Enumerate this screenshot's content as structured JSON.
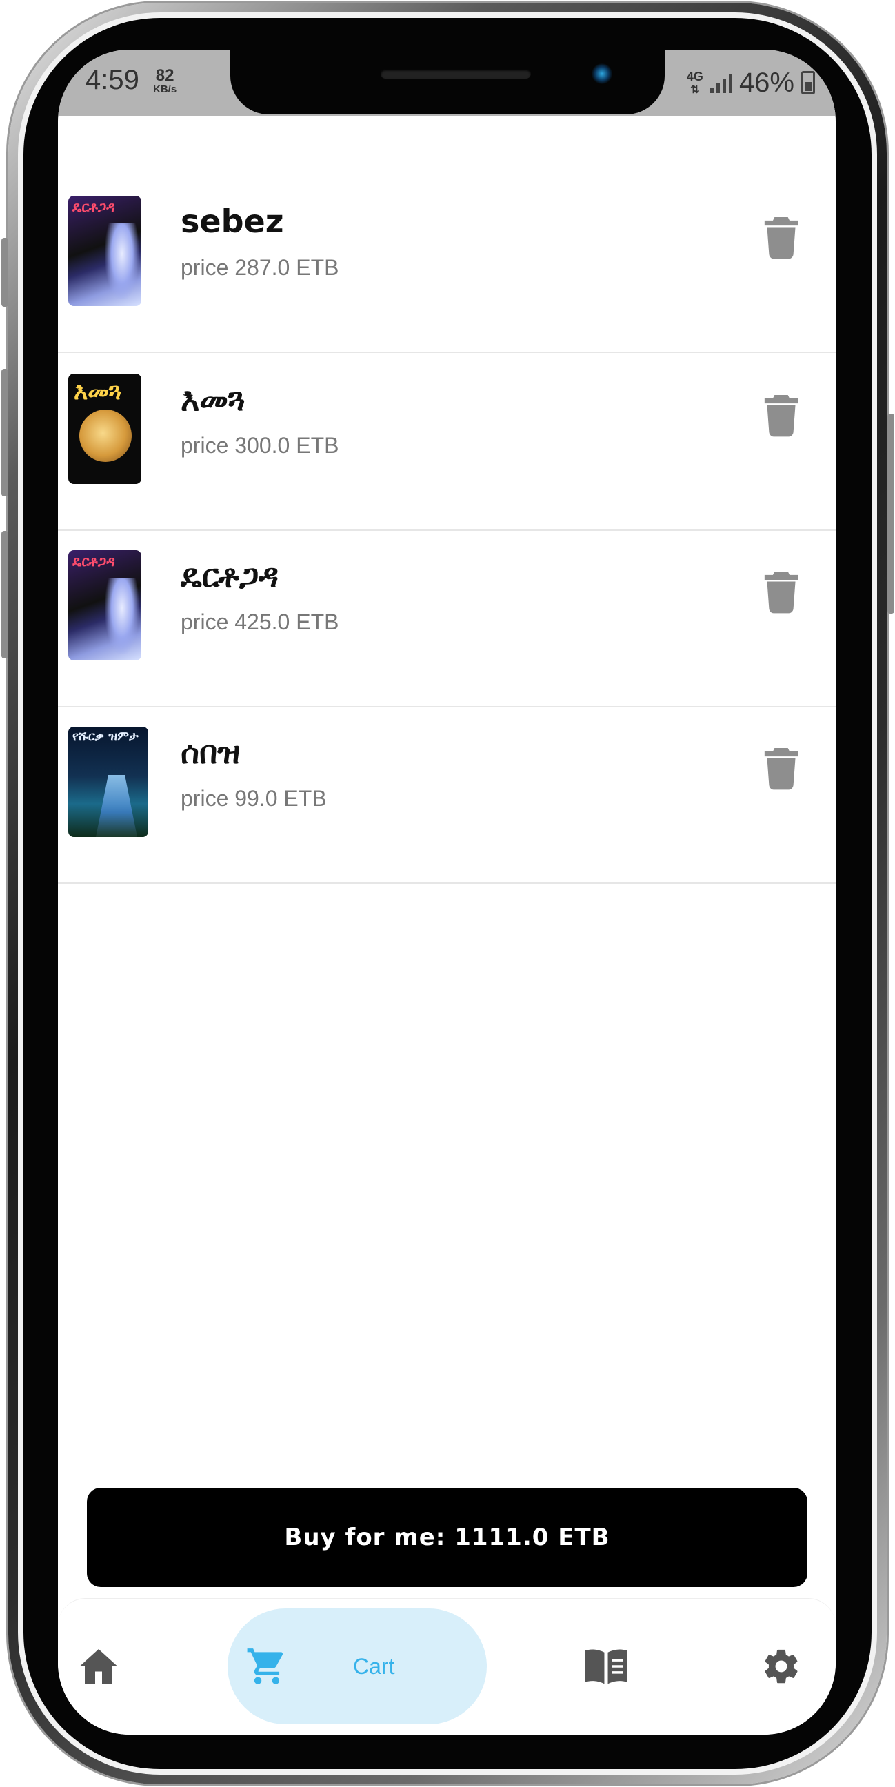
{
  "status_bar": {
    "time": "4:59",
    "speed_value": "82",
    "speed_unit": "KB/s",
    "network": "4G",
    "battery": "46%"
  },
  "cart_items": [
    {
      "title": "sebez",
      "price": "price 287.0 ETB",
      "cover_text": "ዴርቶጋዳ"
    },
    {
      "title": "እመጓ",
      "price": "price 300.0 ETB",
      "cover_text": "እመጓ"
    },
    {
      "title": "ዴርቶጋዳ",
      "price": "price 425.0 ETB",
      "cover_text": "ዴርቶጋዳ"
    },
    {
      "title": "ሰበዝ",
      "price": "price 99.0 ETB",
      "cover_text": "የሹርቃ ዝምታ"
    }
  ],
  "buy_button": {
    "label": "Buy for me: 1111.0 ETB"
  },
  "bottom_nav": {
    "items": [
      {
        "icon": "home-icon",
        "label": ""
      },
      {
        "icon": "cart-icon",
        "label": "Cart"
      },
      {
        "icon": "book-icon",
        "label": ""
      },
      {
        "icon": "gear-icon",
        "label": ""
      }
    ],
    "active_color": "#35b2ea",
    "active_bg": "#d8effa",
    "icon_color": "#555555"
  },
  "colors": {
    "trash": "#8e8e8e",
    "price_text": "#777777",
    "button_bg": "#000000"
  }
}
